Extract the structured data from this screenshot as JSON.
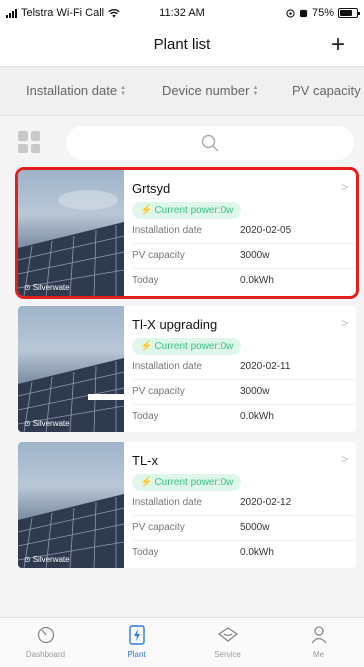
{
  "status_bar": {
    "carrier": "Telstra Wi-Fi Call",
    "time": "11:32 AM",
    "battery": "75%",
    "battery_level": 0.75
  },
  "header": {
    "title": "Plant list",
    "add_label": "+"
  },
  "sort_bar": {
    "items": [
      {
        "label": "Installation date"
      },
      {
        "label": "Device number"
      },
      {
        "label": "PV capacity"
      }
    ]
  },
  "icons": {
    "layout": "grid-icon",
    "search": "search-icon",
    "add": "plus-icon"
  },
  "plants": [
    {
      "name": "Grtsyd",
      "watermark": "Silverwate",
      "power": "Current power:0w",
      "rows": [
        {
          "label": "Installation date",
          "value": "2020-02-05"
        },
        {
          "label": "PV capacity",
          "value": "3000w"
        },
        {
          "label": "Today",
          "value": "0.0kWh"
        }
      ],
      "selected": true
    },
    {
      "name": "Tl-X upgrading",
      "watermark": "Silverwate",
      "power": "Current power:0w",
      "rows": [
        {
          "label": "Installation date",
          "value": "2020-02-11"
        },
        {
          "label": "PV capacity",
          "value": "3000w"
        },
        {
          "label": "Today",
          "value": "0.0kWh"
        }
      ],
      "selected": false
    },
    {
      "name": "TL-x",
      "watermark": "Silverwate",
      "power": "Current power:0w",
      "rows": [
        {
          "label": "Installation date",
          "value": "2020-02-12"
        },
        {
          "label": "PV capacity",
          "value": "5000w"
        },
        {
          "label": "Today",
          "value": "0.0kWh"
        }
      ],
      "selected": false
    }
  ],
  "tab_bar": {
    "tabs": [
      {
        "label": "Dashboard",
        "icon": "dashboard-icon",
        "active": false
      },
      {
        "label": "Plant",
        "icon": "plant-icon",
        "active": true
      },
      {
        "label": "Service",
        "icon": "service-icon",
        "active": false
      },
      {
        "label": "Me",
        "icon": "me-icon",
        "active": false
      }
    ]
  },
  "colors": {
    "accent": "#2a78e4",
    "power_green": "#3bc47f",
    "selection_red": "#e21f1f"
  }
}
